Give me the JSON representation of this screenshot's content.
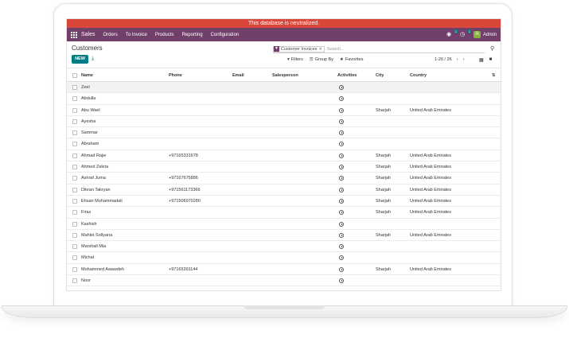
{
  "banner": {
    "text": "This database is neutralized."
  },
  "navbar": {
    "app": "Sales",
    "menu": [
      "Orders",
      "To Invoice",
      "Products",
      "Reporting",
      "Configuration"
    ],
    "chat_count": "1",
    "activity_count": "1",
    "user_initial": "A",
    "user_name": "Admin"
  },
  "control_panel": {
    "title": "Customers",
    "new_label": "NEW",
    "search_facet": "Customer Invoices",
    "search_placeholder": "Search...",
    "filters_label": "Filters",
    "groupby_label": "Group By",
    "favorites_label": "Favorites",
    "pager": "1-26 / 26"
  },
  "table": {
    "columns": {
      "name": "Name",
      "phone": "Phone",
      "email": "Email",
      "salesperson": "Salesperson",
      "activities": "Activities",
      "city": "City",
      "country": "Country"
    },
    "rows": [
      {
        "name": "Zeel",
        "phone": "",
        "city": "",
        "country": ""
      },
      {
        "name": "Abdulla",
        "phone": "",
        "city": "",
        "country": ""
      },
      {
        "name": "Abu Wael",
        "phone": "",
        "city": "Sharjah",
        "country": "United Arab Emirates"
      },
      {
        "name": "Ayesha",
        "phone": "",
        "city": "",
        "country": ""
      },
      {
        "name": "Sammar",
        "phone": "",
        "city": "",
        "country": ""
      },
      {
        "name": "Abraham",
        "phone": "",
        "city": "",
        "country": ""
      },
      {
        "name": "Ahmad Rajie",
        "phone": "+97165331678",
        "city": "Sharjah",
        "country": "United Arab Emirates"
      },
      {
        "name": "Ahmed Zekria",
        "phone": "",
        "city": "Sharjah",
        "country": "United Arab Emirates"
      },
      {
        "name": "Ashraf Juma",
        "phone": "+97167675886",
        "city": "Sharjah",
        "country": "United Arab Emirates"
      },
      {
        "name": "Dikran Takryan",
        "phone": "+971561173366",
        "city": "Sharjah",
        "country": "United Arab Emirates"
      },
      {
        "name": "Ehsan Mohammadali",
        "phone": "+971506970280",
        "city": "Sharjah",
        "country": "United Arab Emirates"
      },
      {
        "name": "Firas",
        "phone": "",
        "city": "Sharjah",
        "country": "United Arab Emirates"
      },
      {
        "name": "Kashish",
        "phone": "",
        "city": "",
        "country": ""
      },
      {
        "name": "Mahlet Sollyana",
        "phone": "",
        "city": "Sharjah",
        "country": "United Arab Emirates"
      },
      {
        "name": "Marshall Mia",
        "phone": "",
        "city": "",
        "country": ""
      },
      {
        "name": "Michal",
        "phone": "",
        "city": "",
        "country": ""
      },
      {
        "name": "Mohammed Awawdeh",
        "phone": "+97165391144",
        "city": "Sharjah",
        "country": "United Arab Emirates"
      },
      {
        "name": "Noor",
        "phone": "",
        "city": "",
        "country": ""
      }
    ]
  }
}
